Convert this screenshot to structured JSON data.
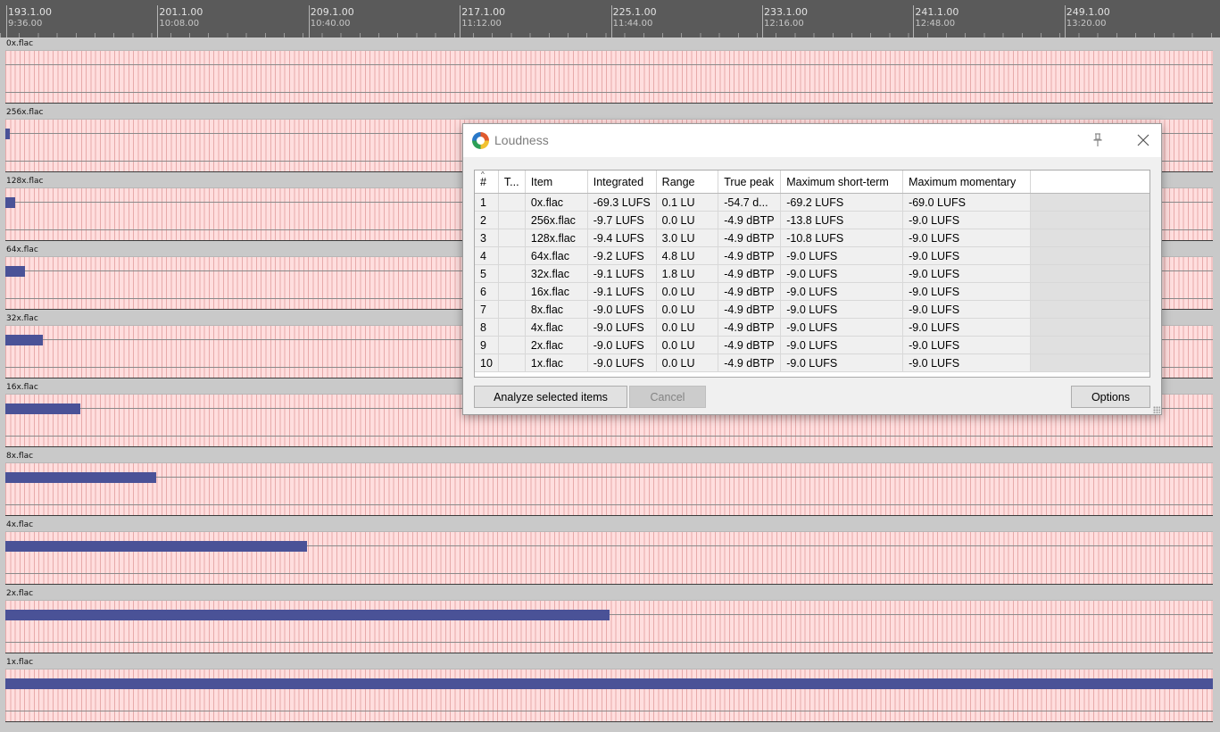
{
  "ruler": {
    "marks": [
      {
        "measure": "193.1.00",
        "time": "9:36.00"
      },
      {
        "measure": "201.1.00",
        "time": "10:08.00"
      },
      {
        "measure": "209.1.00",
        "time": "10:40.00"
      },
      {
        "measure": "217.1.00",
        "time": "11:12.00"
      },
      {
        "measure": "225.1.00",
        "time": "11:44.00"
      },
      {
        "measure": "233.1.00",
        "time": "12:16.00"
      },
      {
        "measure": "241.1.00",
        "time": "12:48.00"
      },
      {
        "measure": "249.1.00",
        "time": "13:20.00"
      }
    ]
  },
  "tracks": [
    {
      "name": "0x.flac",
      "loudness_fraction": 0.0
    },
    {
      "name": "256x.flac",
      "loudness_fraction": 0.004
    },
    {
      "name": "128x.flac",
      "loudness_fraction": 0.008
    },
    {
      "name": "64x.flac",
      "loudness_fraction": 0.016
    },
    {
      "name": "32x.flac",
      "loudness_fraction": 0.031
    },
    {
      "name": "16x.flac",
      "loudness_fraction": 0.062
    },
    {
      "name": "8x.flac",
      "loudness_fraction": 0.125
    },
    {
      "name": "4x.flac",
      "loudness_fraction": 0.25
    },
    {
      "name": "2x.flac",
      "loudness_fraction": 0.5
    },
    {
      "name": "1x.flac",
      "loudness_fraction": 1.0
    }
  ],
  "dialog": {
    "title": "Loudness",
    "app_icon": "reaper-logo-icon",
    "pin_icon": "pin-icon",
    "close_icon": "close-icon",
    "columns": [
      "#",
      "T...",
      "Item",
      "Integrated",
      "Range",
      "True peak",
      "Maximum short-term",
      "Maximum momentary"
    ],
    "rows": [
      [
        "1",
        "",
        "0x.flac",
        "-69.3 LUFS",
        "0.1 LU",
        "-54.7 d...",
        "-69.2 LUFS",
        "-69.0 LUFS"
      ],
      [
        "2",
        "",
        "256x.flac",
        "-9.7 LUFS",
        "0.0 LU",
        "-4.9 dBTP",
        "-13.8 LUFS",
        "-9.0 LUFS"
      ],
      [
        "3",
        "",
        "128x.flac",
        "-9.4 LUFS",
        "3.0 LU",
        "-4.9 dBTP",
        "-10.8 LUFS",
        "-9.0 LUFS"
      ],
      [
        "4",
        "",
        "64x.flac",
        "-9.2 LUFS",
        "4.8 LU",
        "-4.9 dBTP",
        "-9.0 LUFS",
        "-9.0 LUFS"
      ],
      [
        "5",
        "",
        "32x.flac",
        "-9.1 LUFS",
        "1.8 LU",
        "-4.9 dBTP",
        "-9.0 LUFS",
        "-9.0 LUFS"
      ],
      [
        "6",
        "",
        "16x.flac",
        "-9.1 LUFS",
        "0.0 LU",
        "-4.9 dBTP",
        "-9.0 LUFS",
        "-9.0 LUFS"
      ],
      [
        "7",
        "",
        "8x.flac",
        "-9.0 LUFS",
        "0.0 LU",
        "-4.9 dBTP",
        "-9.0 LUFS",
        "-9.0 LUFS"
      ],
      [
        "8",
        "",
        "4x.flac",
        "-9.0 LUFS",
        "0.0 LU",
        "-4.9 dBTP",
        "-9.0 LUFS",
        "-9.0 LUFS"
      ],
      [
        "9",
        "",
        "2x.flac",
        "-9.0 LUFS",
        "0.0 LU",
        "-4.9 dBTP",
        "-9.0 LUFS",
        "-9.0 LUFS"
      ],
      [
        "10",
        "",
        "1x.flac",
        "-9.0 LUFS",
        "0.0 LU",
        "-4.9 dBTP",
        "-9.0 LUFS",
        "-9.0 LUFS"
      ]
    ],
    "buttons": {
      "analyze": "Analyze selected items",
      "cancel": "Cancel",
      "options": "Options"
    }
  },
  "colors": {
    "item_background": "#ffdede",
    "loudness_bar": "#4a5297",
    "ruler_background": "#5a5a5a"
  }
}
